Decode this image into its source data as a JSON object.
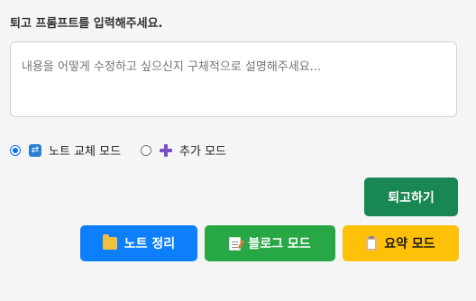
{
  "prompt": {
    "label": "퇴고 프롬프트를 입력해주세요.",
    "placeholder": "내용을 어떻게 수정하고 싶으신지 구체적으로 설명해주세요..."
  },
  "modes": [
    {
      "label": "노트 교체 모드",
      "icon": "swap-icon",
      "checked": true
    },
    {
      "label": "추가 모드",
      "icon": "plus-icon",
      "checked": false
    }
  ],
  "buttons": {
    "rewrite": "퇴고하기",
    "note": "노트 정리",
    "blog": "블로그 모드",
    "summary": "요약 모드"
  },
  "colors": {
    "rewrite": "#198754",
    "note": "#0d7ffa",
    "blog": "#28a745",
    "summary": "#ffc107",
    "radio_accent": "#0b6cf5"
  }
}
